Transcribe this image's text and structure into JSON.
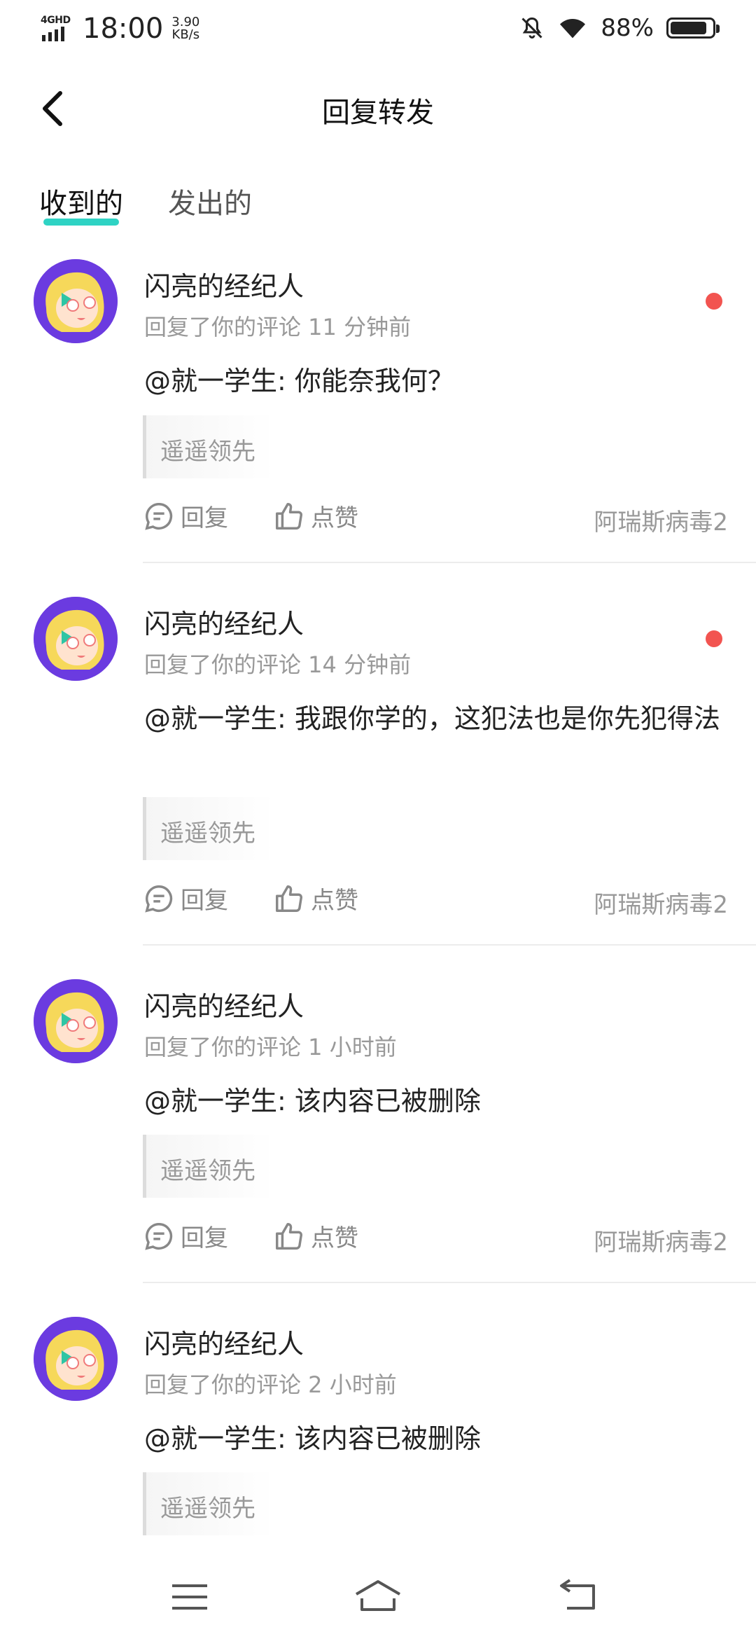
{
  "status_bar": {
    "network": "4GHD",
    "time": "18:00",
    "speed_value": "3.90",
    "speed_unit": "KB/s",
    "battery": "88%",
    "battery_level": 0.88,
    "icons": [
      "signal-icon",
      "mute-bell-icon",
      "wifi-icon",
      "battery-icon"
    ]
  },
  "header": {
    "title": "回复转发",
    "back_icon": "back-arrow-icon"
  },
  "tabs": [
    {
      "label": "收到的",
      "active": true
    },
    {
      "label": "发出的",
      "active": false
    }
  ],
  "colors": {
    "accent": "#2fd3c4",
    "unread": "#f25450",
    "avatar_bg": "#6b3be0"
  },
  "items": [
    {
      "name": "闪亮的经纪人",
      "meta": "回复了你的评论 11 分钟前",
      "content": "@就一学生: 你能奈我何？",
      "quote": "遥遥领先",
      "reply_label": "回复",
      "like_label": "点赞",
      "source": "阿瑞斯病毒2",
      "unread": true
    },
    {
      "name": "闪亮的经纪人",
      "meta": "回复了你的评论 14 分钟前",
      "content": "@就一学生: 我跟你学的，这犯法也是你先犯得法",
      "quote": "遥遥领先",
      "reply_label": "回复",
      "like_label": "点赞",
      "source": "阿瑞斯病毒2",
      "unread": true
    },
    {
      "name": "闪亮的经纪人",
      "meta": "回复了你的评论 1 小时前",
      "content": "@就一学生: 该内容已被删除",
      "quote": "遥遥领先",
      "reply_label": "回复",
      "like_label": "点赞",
      "source": "阿瑞斯病毒2",
      "unread": false
    },
    {
      "name": "闪亮的经纪人",
      "meta": "回复了你的评论 2 小时前",
      "content": "@就一学生: 该内容已被删除",
      "quote": "遥遥领先",
      "unread": false
    }
  ],
  "nav_bar": {
    "icons": [
      "menu-icon",
      "home-icon",
      "back-icon"
    ]
  }
}
